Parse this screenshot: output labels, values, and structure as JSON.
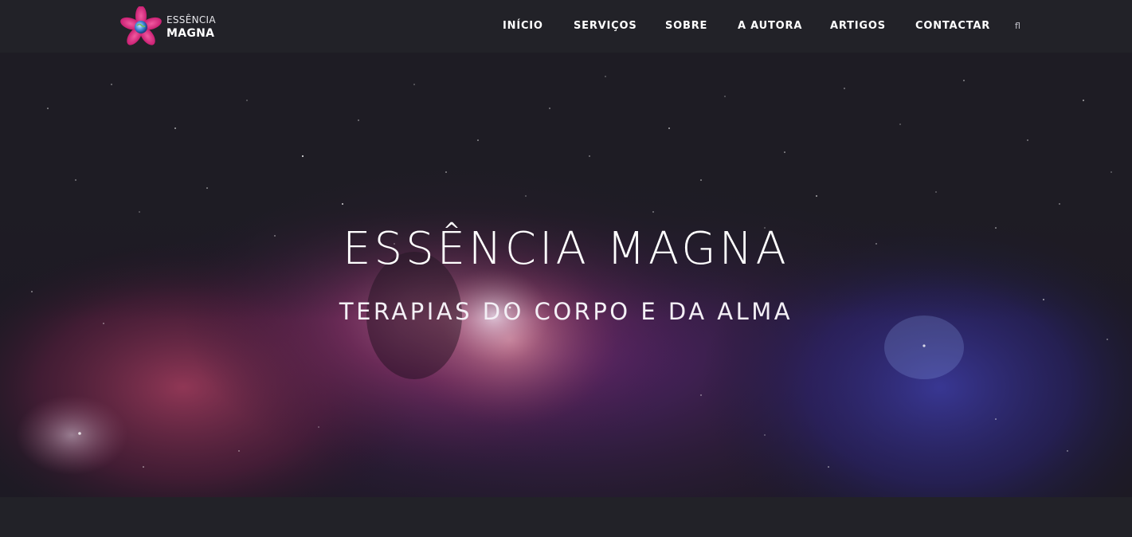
{
  "brand": {
    "logo_line1": "ESSÊNCIA",
    "logo_line2": "MAGNA",
    "logo_icon": "lotus-flower-icon",
    "accent_color": "#d6247a"
  },
  "nav": {
    "items": [
      {
        "label": "INÍCIO"
      },
      {
        "label": "SERVIÇOS"
      },
      {
        "label": "SOBRE"
      },
      {
        "label": "A AUTORA"
      },
      {
        "label": "ARTIGOS"
      },
      {
        "label": "CONTACTAR"
      }
    ],
    "search_icon": "fl"
  },
  "hero": {
    "title": "ESSÊNCIA MAGNA",
    "subtitle": "TERAPIAS DO CORPO E DA ALMA",
    "background": "galaxy-nebula"
  },
  "colors": {
    "header_bg": "#222228",
    "text": "#ffffff"
  }
}
